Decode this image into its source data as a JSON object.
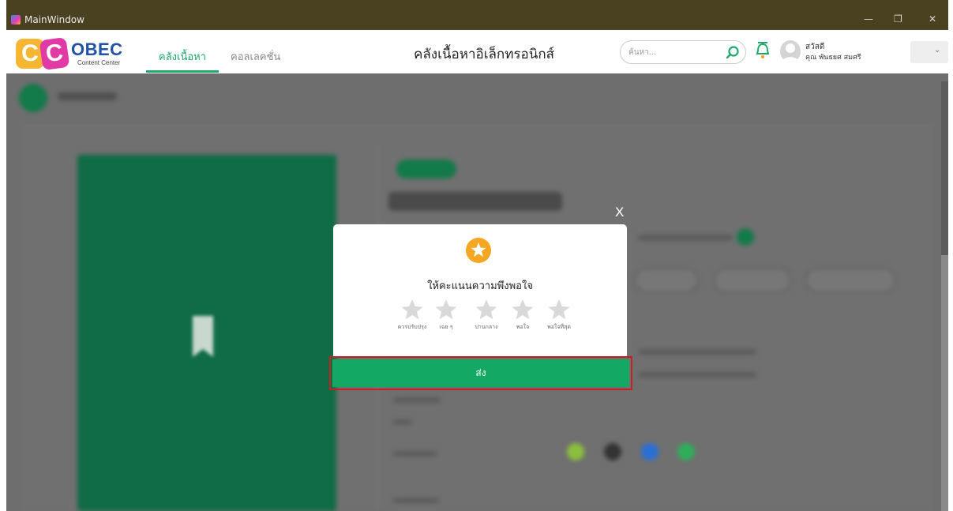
{
  "window": {
    "title": "MainWindow",
    "minimize_glyph": "—",
    "restore_glyph": "❐",
    "close_glyph": "✕"
  },
  "header": {
    "logo_mark_1": "C",
    "logo_mark_2": "C",
    "logo_name": "OBEC",
    "logo_subtitle": "Content Center",
    "tabs": [
      {
        "label": "คลังเนื้อหา",
        "active": true
      },
      {
        "label": "คอลเลคชั่น",
        "active": false
      }
    ],
    "page_title": "คลังเนื้อหาอิเล็กทรอนิกส์",
    "search_placeholder": "ค้นหา...",
    "user_greeting": "สวัสดี",
    "user_name": "คุณ พันธยศ สมศรี",
    "dropdown_icon": "chevron-down-icon",
    "dropdown_glyph": "⌄"
  },
  "modal": {
    "close_label": "X",
    "badge_icon": "star-badge-icon",
    "title": "ให้คะแนนความพึงพอใจ",
    "rating_options": [
      {
        "label": "ควรปรับปรุง"
      },
      {
        "label": "เฉย ๆ"
      },
      {
        "label": "ปานกลาง"
      },
      {
        "label": "พอใจ"
      },
      {
        "label": "พอใจที่สุด"
      }
    ],
    "selected_rating": 0,
    "submit_label": "ส่ง"
  },
  "colors": {
    "accent_green": "#13a863",
    "title_bar": "#49411f",
    "highlight_red": "#c62020",
    "star_badge": "#f5a623",
    "star_empty": "#d9d9d9"
  }
}
